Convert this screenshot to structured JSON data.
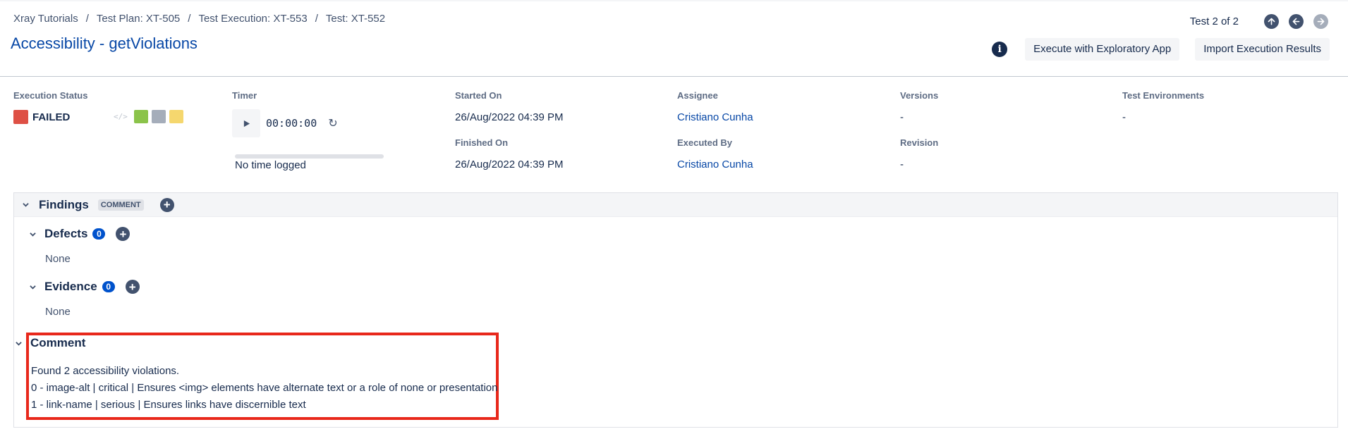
{
  "breadcrumb": [
    "Xray Tutorials",
    "Test Plan: XT-505",
    "Test Execution: XT-553",
    "Test: XT-552"
  ],
  "breadcrumb_separator": "/",
  "page_title": "Accessibility - getViolations",
  "navigation": {
    "counter": "Test 2 of 2",
    "up_icon": "arrow-up-icon",
    "prev_icon": "arrow-left-icon",
    "next_icon": "arrow-right-icon"
  },
  "actions": {
    "info_icon": "info-icon",
    "execute_label": "Execute with Exploratory App",
    "import_label": "Import Execution Results"
  },
  "execution": {
    "status_label": "Execution Status",
    "status_value": "FAILED",
    "status_color": "#de5045",
    "status_options": [
      "#8bc34a",
      "#a5adba",
      "#f5d76e"
    ],
    "timer_label": "Timer",
    "timer_value": "00:00:00",
    "time_logged": "No time logged",
    "time_logged_progress": 0,
    "started_label": "Started On",
    "started_value": "26/Aug/2022 04:39 PM",
    "finished_label": "Finished On",
    "finished_value": "26/Aug/2022 04:39 PM",
    "assignee_label": "Assignee",
    "assignee_value": "Cristiano Cunha",
    "executed_by_label": "Executed By",
    "executed_by_value": "Cristiano Cunha",
    "versions_label": "Versions",
    "versions_value": "-",
    "revision_label": "Revision",
    "revision_value": "-",
    "environments_label": "Test Environments",
    "environments_value": "-"
  },
  "findings": {
    "title": "Findings",
    "badge": "COMMENT",
    "defects": {
      "title": "Defects",
      "count": "0",
      "body": "None"
    },
    "evidence": {
      "title": "Evidence",
      "count": "0",
      "body": "None"
    },
    "comment": {
      "title": "Comment",
      "lines": [
        "Found 2 accessibility violations.",
        "0 - image-alt | critical | Ensures <img> elements have alternate text or a role of none or presentation",
        "1 - link-name | serious | Ensures links have discernible text"
      ]
    }
  }
}
